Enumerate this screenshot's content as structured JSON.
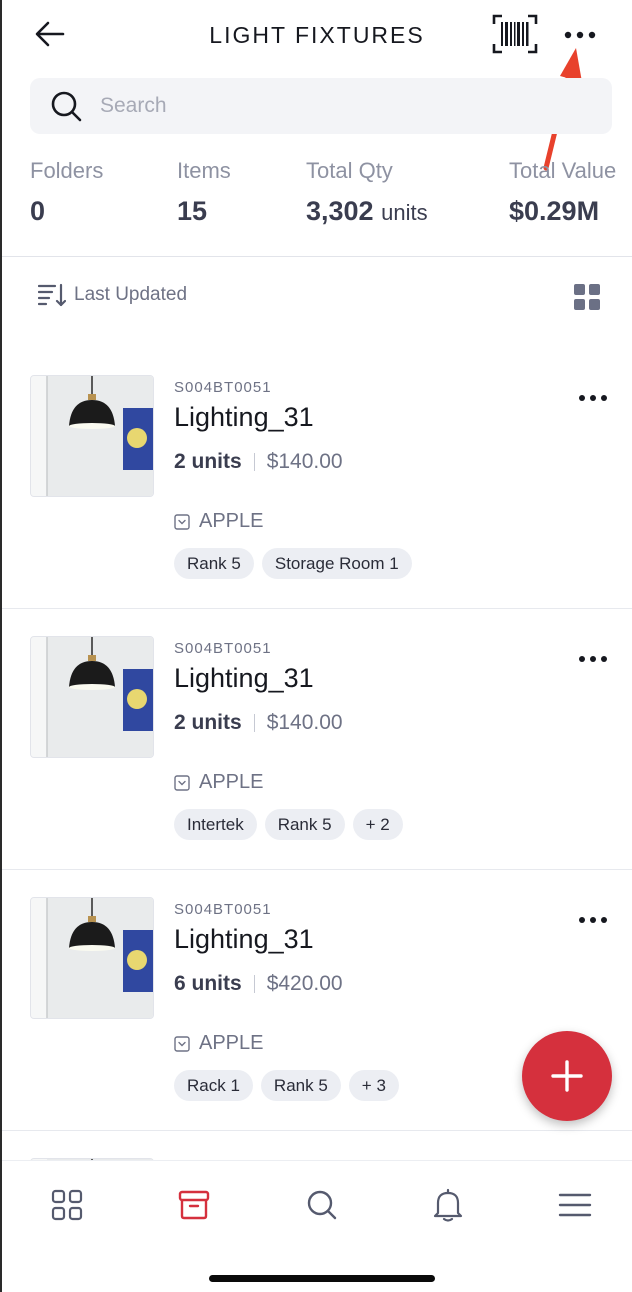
{
  "header": {
    "title": "LIGHT FIXTURES",
    "back_icon": "arrow-left-icon",
    "barcode_icon": "barcode-scan-icon",
    "more_icon": "more-horizontal-icon"
  },
  "search": {
    "placeholder": "Search",
    "icon": "search-icon"
  },
  "stats": [
    {
      "label": "Folders",
      "value": "0",
      "unit": ""
    },
    {
      "label": "Items",
      "value": "15",
      "unit": ""
    },
    {
      "label": "Total Qty",
      "value": "3,302",
      "unit": "units"
    },
    {
      "label": "Total Value",
      "value": "$0.29M",
      "unit": ""
    }
  ],
  "sort": {
    "label": "Last Updated",
    "icon": "sort-icon",
    "view_icon": "grid-view-icon"
  },
  "items": [
    {
      "sku": "S004BT0051",
      "name": "Lighting_31",
      "qty": "2 units",
      "price": "$140.00",
      "brand": "APPLE",
      "tags": [
        "Rank 5",
        "Storage Room 1"
      ]
    },
    {
      "sku": "S004BT0051",
      "name": "Lighting_31",
      "qty": "2 units",
      "price": "$140.00",
      "brand": "APPLE",
      "tags": [
        "Intertek",
        "Rank 5",
        "+ 2"
      ]
    },
    {
      "sku": "S004BT0051",
      "name": "Lighting_31",
      "qty": "6 units",
      "price": "$420.00",
      "brand": "APPLE",
      "tags": [
        "Rack 1",
        "Rank 5",
        "+ 3"
      ]
    }
  ],
  "fab": {
    "icon": "plus-icon"
  },
  "bottom_nav": [
    {
      "name": "dashboard",
      "icon": "dashboard-icon",
      "active": false
    },
    {
      "name": "items",
      "icon": "box-icon",
      "active": true
    },
    {
      "name": "search",
      "icon": "search-icon",
      "active": false
    },
    {
      "name": "notifications",
      "icon": "bell-icon",
      "active": false
    },
    {
      "name": "menu",
      "icon": "menu-icon",
      "active": false
    }
  ],
  "colors": {
    "accent": "#d5303d",
    "annotation": "#e8412c",
    "text": "#1f2130",
    "muted": "#6e7285",
    "tag_bg": "#eceef3"
  }
}
